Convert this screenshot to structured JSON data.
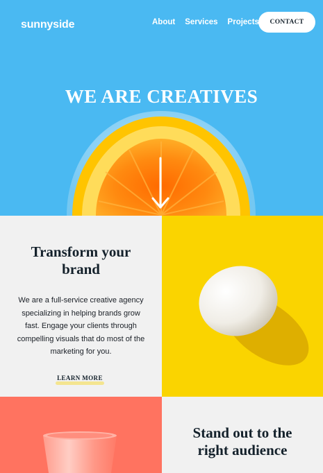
{
  "header": {
    "logo": "sunnyside",
    "nav": [
      "About",
      "Services",
      "Projects"
    ],
    "contact_label": "CONTACT"
  },
  "hero": {
    "title": "WE ARE CREATIVES"
  },
  "features": [
    {
      "title_lines": [
        "Transform your",
        "brand"
      ],
      "body": "We are a full-service creative agency specializing in helping brands grow fast. Engage your clients through compelling visuals that do most of the marketing for you.",
      "link": "LEARN MORE"
    },
    {
      "title_lines": [
        "Stand out to the",
        "right audience"
      ]
    }
  ],
  "colors": {
    "hero_blue": "#4ab9f2",
    "yellow": "#fad400",
    "coral": "#ff7360",
    "dark_text": "#14212b",
    "light_bg": "#f1f1f1"
  },
  "icons": [
    "arrow-down-icon"
  ]
}
